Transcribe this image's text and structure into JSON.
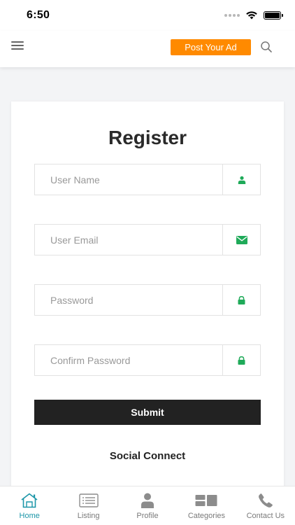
{
  "status_bar": {
    "time": "6:50"
  },
  "header": {
    "post_ad_label": "Post Your Ad"
  },
  "form": {
    "title": "Register",
    "fields": [
      {
        "placeholder": "User Name",
        "value": "",
        "icon": "user-icon"
      },
      {
        "placeholder": "User Email",
        "value": "",
        "icon": "envelope-icon"
      },
      {
        "placeholder": "Password",
        "value": "",
        "icon": "lock-icon"
      },
      {
        "placeholder": "Confirm Password",
        "value": "",
        "icon": "lock-icon"
      }
    ],
    "submit_label": "Submit",
    "social_title": "Social Connect"
  },
  "tab_bar": {
    "items": [
      {
        "label": "Home",
        "icon": "home-icon",
        "active": true
      },
      {
        "label": "Listing",
        "icon": "list-icon",
        "active": false
      },
      {
        "label": "Profile",
        "icon": "person-icon",
        "active": false
      },
      {
        "label": "Categories",
        "icon": "categories-icon",
        "active": false
      },
      {
        "label": "Contact Us",
        "icon": "phone-icon",
        "active": false
      }
    ]
  },
  "colors": {
    "accent_orange": "#ff8a00",
    "icon_green": "#1faa59",
    "active_tab": "#1c96a8",
    "submit_bg": "#222222"
  }
}
